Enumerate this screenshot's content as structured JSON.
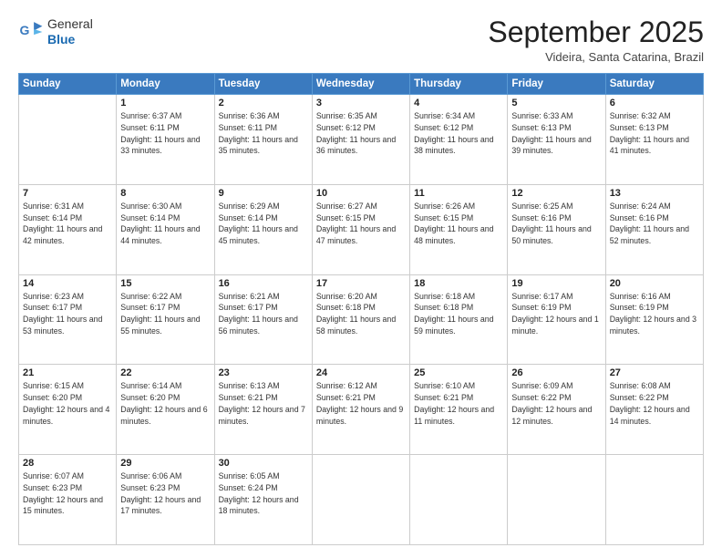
{
  "header": {
    "logo": {
      "general": "General",
      "blue": "Blue"
    },
    "title": "September 2025",
    "location": "Videira, Santa Catarina, Brazil"
  },
  "days_of_week": [
    "Sunday",
    "Monday",
    "Tuesday",
    "Wednesday",
    "Thursday",
    "Friday",
    "Saturday"
  ],
  "weeks": [
    [
      {
        "day": "",
        "content": ""
      },
      {
        "day": "1",
        "content": "Sunrise: 6:37 AM\nSunset: 6:11 PM\nDaylight: 11 hours\nand 33 minutes."
      },
      {
        "day": "2",
        "content": "Sunrise: 6:36 AM\nSunset: 6:11 PM\nDaylight: 11 hours\nand 35 minutes."
      },
      {
        "day": "3",
        "content": "Sunrise: 6:35 AM\nSunset: 6:12 PM\nDaylight: 11 hours\nand 36 minutes."
      },
      {
        "day": "4",
        "content": "Sunrise: 6:34 AM\nSunset: 6:12 PM\nDaylight: 11 hours\nand 38 minutes."
      },
      {
        "day": "5",
        "content": "Sunrise: 6:33 AM\nSunset: 6:13 PM\nDaylight: 11 hours\nand 39 minutes."
      },
      {
        "day": "6",
        "content": "Sunrise: 6:32 AM\nSunset: 6:13 PM\nDaylight: 11 hours\nand 41 minutes."
      }
    ],
    [
      {
        "day": "7",
        "content": "Sunrise: 6:31 AM\nSunset: 6:14 PM\nDaylight: 11 hours\nand 42 minutes."
      },
      {
        "day": "8",
        "content": "Sunrise: 6:30 AM\nSunset: 6:14 PM\nDaylight: 11 hours\nand 44 minutes."
      },
      {
        "day": "9",
        "content": "Sunrise: 6:29 AM\nSunset: 6:14 PM\nDaylight: 11 hours\nand 45 minutes."
      },
      {
        "day": "10",
        "content": "Sunrise: 6:27 AM\nSunset: 6:15 PM\nDaylight: 11 hours\nand 47 minutes."
      },
      {
        "day": "11",
        "content": "Sunrise: 6:26 AM\nSunset: 6:15 PM\nDaylight: 11 hours\nand 48 minutes."
      },
      {
        "day": "12",
        "content": "Sunrise: 6:25 AM\nSunset: 6:16 PM\nDaylight: 11 hours\nand 50 minutes."
      },
      {
        "day": "13",
        "content": "Sunrise: 6:24 AM\nSunset: 6:16 PM\nDaylight: 11 hours\nand 52 minutes."
      }
    ],
    [
      {
        "day": "14",
        "content": "Sunrise: 6:23 AM\nSunset: 6:17 PM\nDaylight: 11 hours\nand 53 minutes."
      },
      {
        "day": "15",
        "content": "Sunrise: 6:22 AM\nSunset: 6:17 PM\nDaylight: 11 hours\nand 55 minutes."
      },
      {
        "day": "16",
        "content": "Sunrise: 6:21 AM\nSunset: 6:17 PM\nDaylight: 11 hours\nand 56 minutes."
      },
      {
        "day": "17",
        "content": "Sunrise: 6:20 AM\nSunset: 6:18 PM\nDaylight: 11 hours\nand 58 minutes."
      },
      {
        "day": "18",
        "content": "Sunrise: 6:18 AM\nSunset: 6:18 PM\nDaylight: 11 hours\nand 59 minutes."
      },
      {
        "day": "19",
        "content": "Sunrise: 6:17 AM\nSunset: 6:19 PM\nDaylight: 12 hours\nand 1 minute."
      },
      {
        "day": "20",
        "content": "Sunrise: 6:16 AM\nSunset: 6:19 PM\nDaylight: 12 hours\nand 3 minutes."
      }
    ],
    [
      {
        "day": "21",
        "content": "Sunrise: 6:15 AM\nSunset: 6:20 PM\nDaylight: 12 hours\nand 4 minutes."
      },
      {
        "day": "22",
        "content": "Sunrise: 6:14 AM\nSunset: 6:20 PM\nDaylight: 12 hours\nand 6 minutes."
      },
      {
        "day": "23",
        "content": "Sunrise: 6:13 AM\nSunset: 6:21 PM\nDaylight: 12 hours\nand 7 minutes."
      },
      {
        "day": "24",
        "content": "Sunrise: 6:12 AM\nSunset: 6:21 PM\nDaylight: 12 hours\nand 9 minutes."
      },
      {
        "day": "25",
        "content": "Sunrise: 6:10 AM\nSunset: 6:21 PM\nDaylight: 12 hours\nand 11 minutes."
      },
      {
        "day": "26",
        "content": "Sunrise: 6:09 AM\nSunset: 6:22 PM\nDaylight: 12 hours\nand 12 minutes."
      },
      {
        "day": "27",
        "content": "Sunrise: 6:08 AM\nSunset: 6:22 PM\nDaylight: 12 hours\nand 14 minutes."
      }
    ],
    [
      {
        "day": "28",
        "content": "Sunrise: 6:07 AM\nSunset: 6:23 PM\nDaylight: 12 hours\nand 15 minutes."
      },
      {
        "day": "29",
        "content": "Sunrise: 6:06 AM\nSunset: 6:23 PM\nDaylight: 12 hours\nand 17 minutes."
      },
      {
        "day": "30",
        "content": "Sunrise: 6:05 AM\nSunset: 6:24 PM\nDaylight: 12 hours\nand 18 minutes."
      },
      {
        "day": "",
        "content": ""
      },
      {
        "day": "",
        "content": ""
      },
      {
        "day": "",
        "content": ""
      },
      {
        "day": "",
        "content": ""
      }
    ]
  ]
}
